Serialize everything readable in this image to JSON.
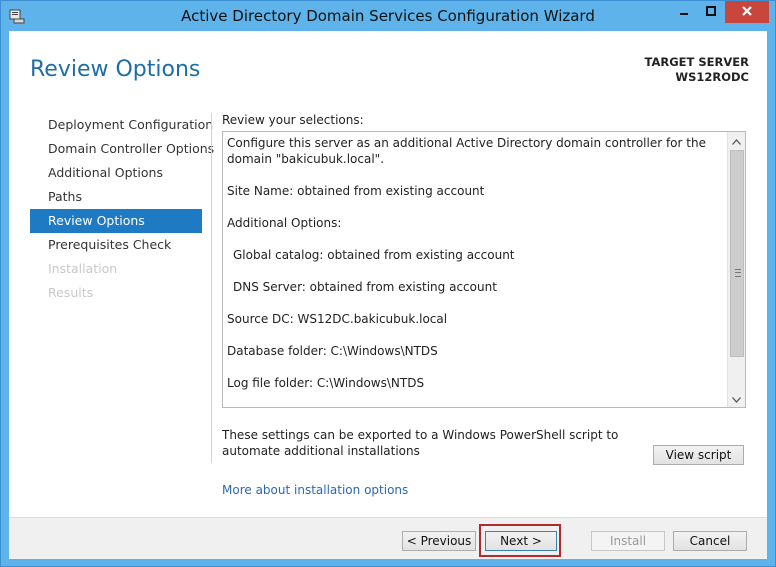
{
  "window": {
    "title": "Active Directory Domain Services Configuration Wizard"
  },
  "header": {
    "page_title": "Review Options",
    "target_label": "TARGET SERVER",
    "target_server": "WS12RODC"
  },
  "nav": {
    "items": [
      {
        "label": "Deployment Configuration",
        "state": "normal"
      },
      {
        "label": "Domain Controller Options",
        "state": "normal"
      },
      {
        "label": "Additional Options",
        "state": "normal"
      },
      {
        "label": "Paths",
        "state": "normal"
      },
      {
        "label": "Review Options",
        "state": "active"
      },
      {
        "label": "Prerequisites Check",
        "state": "normal"
      },
      {
        "label": "Installation",
        "state": "disabled"
      },
      {
        "label": "Results",
        "state": "disabled"
      }
    ]
  },
  "review": {
    "label": "Review your selections:",
    "lines": [
      "Configure this server as an additional Active Directory domain controller for the domain \"bakicubuk.local\".",
      "Site Name: obtained from existing account",
      "Additional Options:",
      "Global catalog: obtained from existing account",
      "DNS Server: obtained from existing account",
      "Source DC: WS12DC.bakicubuk.local",
      "Database folder: C:\\Windows\\NTDS",
      "Log file folder: C:\\Windows\\NTDS"
    ]
  },
  "export": {
    "text": "These settings can be exported to a Windows PowerShell script to automate additional installations",
    "view_script_label": "View script"
  },
  "more_link": "More about installation options",
  "footer": {
    "previous_label": "< Previous",
    "next_label": "Next >",
    "install_label": "Install",
    "cancel_label": "Cancel"
  },
  "colors": {
    "frame": "#5db3ea",
    "accent": "#1f7ac4",
    "title_text": "#1e6ea5",
    "highlight": "#b02a2e"
  }
}
